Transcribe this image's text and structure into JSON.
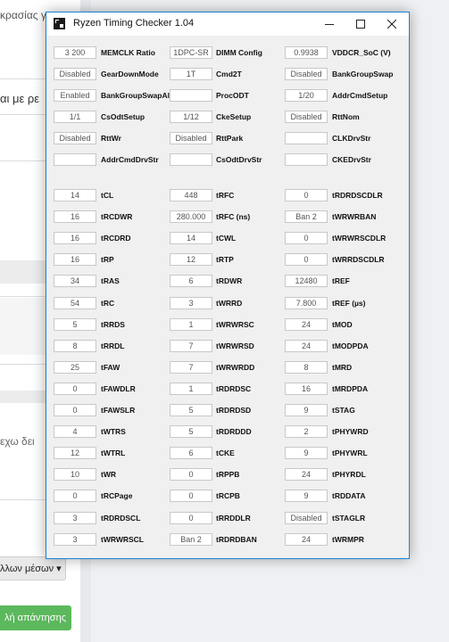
{
  "background": {
    "line1": "κρασίας γι",
    "line2": "αι με ρε",
    "line3": "εχω δει",
    "dropdown": "λλων μέσων ▾",
    "reply": "λή απάντησης"
  },
  "window": {
    "title": "Ryzen Timing Checker 1.04"
  },
  "top_rows": [
    [
      [
        "3 200",
        "MEMCLK Ratio"
      ],
      [
        "1DPC-SR",
        "DIMM Config"
      ],
      [
        "0.9938",
        "VDDCR_SoC (V)"
      ]
    ],
    [
      [
        "Disabled",
        "GearDownMode"
      ],
      [
        "1T",
        "Cmd2T"
      ],
      [
        "Disabled",
        "BankGroupSwap"
      ]
    ],
    [
      [
        "Enabled",
        "BankGroupSwapAlt"
      ],
      [
        "",
        "ProcODT"
      ],
      [
        "1/20",
        "AddrCmdSetup"
      ]
    ],
    [
      [
        "1/1",
        "CsOdtSetup"
      ],
      [
        "1/12",
        "CkeSetup"
      ],
      [
        "Disabled",
        "RttNom"
      ]
    ],
    [
      [
        "Disabled",
        "RttWr"
      ],
      [
        "Disabled",
        "RttPark"
      ],
      [
        "",
        "CLKDrvStr"
      ]
    ],
    [
      [
        "",
        "AddrCmdDrvStr"
      ],
      [
        "",
        "CsOdtDrvStr"
      ],
      [
        "",
        "CKEDrvStr"
      ]
    ]
  ],
  "timing_rows": [
    [
      [
        "14",
        "tCL"
      ],
      [
        "448",
        "tRFC"
      ],
      [
        "0",
        "tRDRDSCDLR"
      ]
    ],
    [
      [
        "16",
        "tRCDWR"
      ],
      [
        "280.000",
        "tRFC (ns)"
      ],
      [
        "Ban 2",
        "tWRWRBAN"
      ]
    ],
    [
      [
        "16",
        "tRCDRD"
      ],
      [
        "14",
        "tCWL"
      ],
      [
        "0",
        "tWRWRSCDLR"
      ]
    ],
    [
      [
        "16",
        "tRP"
      ],
      [
        "12",
        "tRTP"
      ],
      [
        "0",
        "tWRRDSCDLR"
      ]
    ],
    [
      [
        "34",
        "tRAS"
      ],
      [
        "6",
        "tRDWR"
      ],
      [
        "12480",
        "tREF"
      ]
    ],
    [
      [
        "54",
        "tRC"
      ],
      [
        "3",
        "tWRRD"
      ],
      [
        "7.800",
        "tREF (µs)"
      ]
    ],
    [
      [
        "5",
        "tRRDS"
      ],
      [
        "1",
        "tWRWRSC"
      ],
      [
        "24",
        "tMOD"
      ]
    ],
    [
      [
        "8",
        "tRRDL"
      ],
      [
        "7",
        "tWRWRSD"
      ],
      [
        "24",
        "tMODPDA"
      ]
    ],
    [
      [
        "25",
        "tFAW"
      ],
      [
        "7",
        "tWRWRDD"
      ],
      [
        "8",
        "tMRD"
      ]
    ],
    [
      [
        "0",
        "tFAWDLR"
      ],
      [
        "1",
        "tRDRDSC"
      ],
      [
        "16",
        "tMRDPDA"
      ]
    ],
    [
      [
        "0",
        "tFAWSLR"
      ],
      [
        "5",
        "tRDRDSD"
      ],
      [
        "9",
        "tSTAG"
      ]
    ],
    [
      [
        "4",
        "tWTRS"
      ],
      [
        "5",
        "tRDRDDD"
      ],
      [
        "2",
        "tPHYWRD"
      ]
    ],
    [
      [
        "12",
        "tWTRL"
      ],
      [
        "6",
        "tCKE"
      ],
      [
        "9",
        "tPHYWRL"
      ]
    ],
    [
      [
        "10",
        "tWR"
      ],
      [
        "0",
        "tRPPB"
      ],
      [
        "24",
        "tPHYRDL"
      ]
    ],
    [
      [
        "0",
        "tRCPage"
      ],
      [
        "0",
        "tRCPB"
      ],
      [
        "9",
        "tRDDATA"
      ]
    ],
    [
      [
        "3",
        "tRDRDSCL"
      ],
      [
        "0",
        "tRRDDLR"
      ],
      [
        "Disabled",
        "tSTAGLR"
      ]
    ],
    [
      [
        "3",
        "tWRWRSCL"
      ],
      [
        "Ban 2",
        "tRDRDBAN"
      ],
      [
        "24",
        "tWRMPR"
      ]
    ]
  ],
  "icons": {
    "app": "ryzen-app-icon",
    "minimize": "minimize-icon",
    "maximize": "maximize-icon",
    "close": "close-icon"
  }
}
